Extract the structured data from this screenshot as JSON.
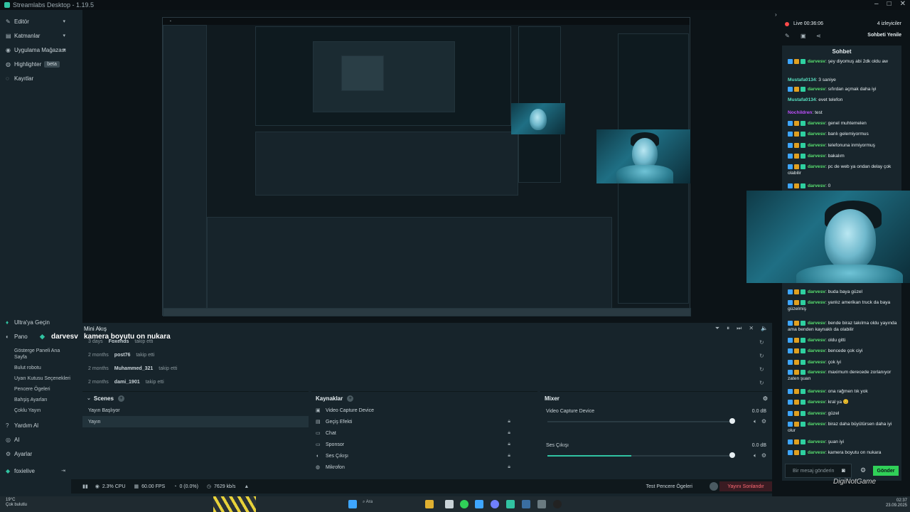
{
  "window": {
    "title": "Streamlabs Desktop - 1.19.5"
  },
  "sidebar": {
    "items": [
      {
        "label": "Editör",
        "icon": "edit-icon"
      },
      {
        "label": "Katmanlar",
        "icon": "layers-icon"
      },
      {
        "label": "Uygulama Mağazası",
        "icon": "store-icon"
      },
      {
        "label": "Highlighter",
        "icon": "highlighter-icon",
        "badge": "beta"
      },
      {
        "label": "Kayıtlar",
        "icon": "recordings-icon"
      }
    ],
    "bottom": [
      {
        "label": "Ultra'ya Geçin",
        "icon": "ultra-icon"
      },
      {
        "label": "Pano",
        "icon": "dashboard-icon"
      }
    ],
    "sub": [
      "Gösterge Paneli Ana Sayfa",
      "Bulut robotu",
      "Uyarı Kutusu Seçenekleri",
      "Pencere Ögeleri",
      "Bahşiş Ayarları",
      "Çoklu Yayın"
    ],
    "bottom2": [
      {
        "label": "Yardım Al",
        "icon": "help-icon"
      },
      {
        "label": "AI",
        "icon": "ai-icon"
      },
      {
        "label": "Ayarlar",
        "icon": "settings-icon"
      }
    ],
    "user": "foxielive"
  },
  "activity": {
    "title": "Mini Akış",
    "overlay_user": "darvesv",
    "overlay_msg": "kamera boyutu on nukara",
    "rows": [
      {
        "time": "3 days",
        "user": "Foxends",
        "action": "takip etti"
      },
      {
        "time": "2 months",
        "user": "post76",
        "action": "takip etti"
      },
      {
        "time": "2 months",
        "user": "Muhammed_321",
        "action": "takip etti"
      },
      {
        "time": "2 months",
        "user": "dami_1901",
        "action": "takip etti"
      }
    ]
  },
  "scenes": {
    "title": "Scenes",
    "items": [
      "Yayın Başlıyor",
      "Yayın"
    ]
  },
  "sources": {
    "title": "Kaynaklar",
    "items": [
      "Video Capture Device",
      "Geçiş Efekti",
      "Chat",
      "Sponsor",
      "Ses Çıkışı",
      "Mikrofon"
    ]
  },
  "mixer": {
    "title": "Mixer",
    "channels": [
      {
        "name": "Video Capture Device",
        "db": "0.0 dB",
        "level": 0
      },
      {
        "name": "Ses Çıkışı",
        "db": "0.0 dB",
        "level": 0.45
      }
    ]
  },
  "status": {
    "cpu": "2.3% CPU",
    "fps": "60.00 FPS",
    "dropped": "0 (0.0%)",
    "bitrate": "7629 kb/s",
    "test_label": "Test Pencere Ögeleri",
    "end_label": "Yayını Sonlandır"
  },
  "live": {
    "time": "Live 00:36:06",
    "viewers": "4 izleyiciler",
    "new_chat": "Sohbeti Yenile",
    "chat_title": "Sohbet"
  },
  "chat": {
    "messages": [
      {
        "user": "darvesv",
        "text": ": şey diyomuş abi 2dk oldu aw",
        "style": "badge"
      },
      {
        "user": "Mustafa0134",
        "text": ": 3 saniye",
        "style": "plain"
      },
      {
        "user": "darvesv",
        "text": ": sıfırdan açmak daha iyi",
        "style": "badge"
      },
      {
        "user": "Mustafa0134",
        "text": ": evet telefon",
        "style": "plain"
      },
      {
        "user": "Nochildren",
        "text": ": test",
        "style": "purple"
      },
      {
        "user": "darvesv",
        "text": ": genel muhtemelen",
        "style": "badge"
      },
      {
        "user": "darvesv",
        "text": ": banlı gelemiyormus",
        "style": "badge"
      },
      {
        "user": "darvesv",
        "text": ": telefonuna inmiyormuş",
        "style": "badge"
      },
      {
        "user": "darvesv",
        "text": ": bakalım",
        "style": "badge"
      },
      {
        "user": "darvesv",
        "text": ": pc de web ya ondan delay çok olabilir",
        "style": "badge"
      },
      {
        "user": "darvesv",
        "text": ": 0",
        "style": "badge"
      },
      {
        "user": "darvesv",
        "text": ": buda baya güzel",
        "style": "badge"
      },
      {
        "user": "darvesv",
        "text": ": yanlız amerikan truck da baya güzelmiş",
        "style": "badge"
      },
      {
        "user": "darvesv",
        "text": ": bende biraz takılma oldu yayında ama benden kaynaklı da olabilir",
        "style": "badge"
      },
      {
        "user": "darvesv",
        "text": ": oldu gitti",
        "style": "badge"
      },
      {
        "user": "darvesv",
        "text": ": bencede çok ciyi",
        "style": "badge"
      },
      {
        "user": "darvesv",
        "text": ": çok iyi",
        "style": "badge"
      },
      {
        "user": "darvesv",
        "text": ": maximum derecede zorlanıyor zaten şuan",
        "style": "badge"
      },
      {
        "user": "darvesv",
        "text": ": ona rağmen tık yok",
        "style": "badge"
      },
      {
        "user": "darvesv",
        "text": ": kral ya 😊",
        "style": "badge"
      },
      {
        "user": "darvesv",
        "text": ": güzel",
        "style": "badge"
      },
      {
        "user": "darvesv",
        "text": ": biraz daha büyütürsen daha iyi olur",
        "style": "badge"
      },
      {
        "user": "darvesv",
        "text": ": şuan iyi",
        "style": "badge"
      },
      {
        "user": "darvesv",
        "text": ": kamera boyutu on nukara",
        "style": "badge"
      }
    ],
    "input_placeholder": "Bir mesaj gönderin",
    "send_label": "Gönder"
  },
  "watermark": "DigiNotGame",
  "taskbar": {
    "weather_temp": "19°C",
    "weather_desc": "Çok bulutlu",
    "search": "Ara",
    "time": "02:37",
    "date": "23.09.2025"
  }
}
